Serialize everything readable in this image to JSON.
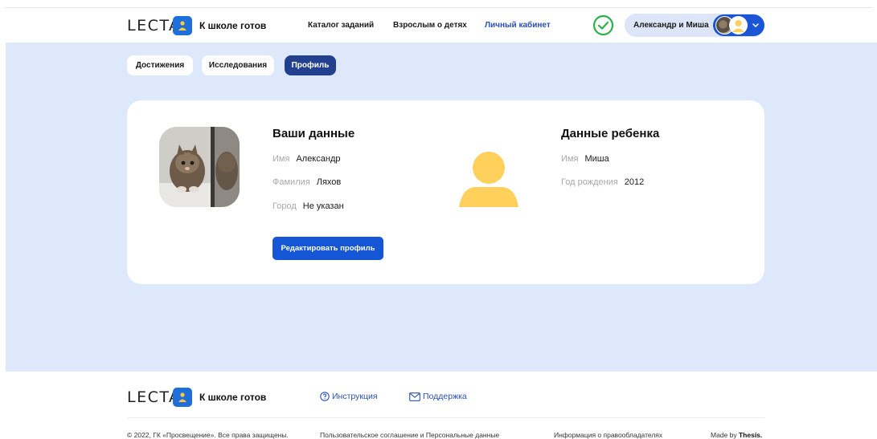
{
  "header": {
    "logo": "LECTA",
    "brand": "К школе готов",
    "nav": [
      {
        "label": "Каталог заданий",
        "active": false
      },
      {
        "label": "Взрослым о детях",
        "active": false
      },
      {
        "label": "Личный кабинет",
        "active": true
      }
    ],
    "user_name": "Александр и Миша"
  },
  "tabs": [
    {
      "label": "Достижения",
      "active": false
    },
    {
      "label": "Исследования",
      "active": false
    },
    {
      "label": "Профиль",
      "active": true
    }
  ],
  "profile": {
    "your_title": "Ваши данные",
    "your_fields": [
      {
        "label": "Имя",
        "value": "Александр"
      },
      {
        "label": "Фамилия",
        "value": "Ляхов"
      },
      {
        "label": "Город",
        "value": "Не указан"
      }
    ],
    "edit_label": "Редактировать профиль",
    "child_title": "Данные ребенка",
    "child_fields": [
      {
        "label": "Имя",
        "value": "Миша"
      },
      {
        "label": "Год рождения",
        "value": "2012"
      }
    ]
  },
  "footer": {
    "logo": "LECTA",
    "brand": "К школе готов",
    "instruction": "Инструкция",
    "support": "Поддержка",
    "copyright": "© 2022, ГК «Просвещение». Все права защищены.",
    "agreement": "Пользовательское соглашение и Персональные данные",
    "rights_info": "Информация о правообладателях",
    "made_by": "Made by",
    "made_by_brand": "Thesis."
  },
  "colors": {
    "accent": "#1456d6",
    "tab_active": "#23408f",
    "page_bg": "#dde8fa",
    "check": "#2bb34a",
    "placeholder_avatar": "#ffd15c"
  }
}
